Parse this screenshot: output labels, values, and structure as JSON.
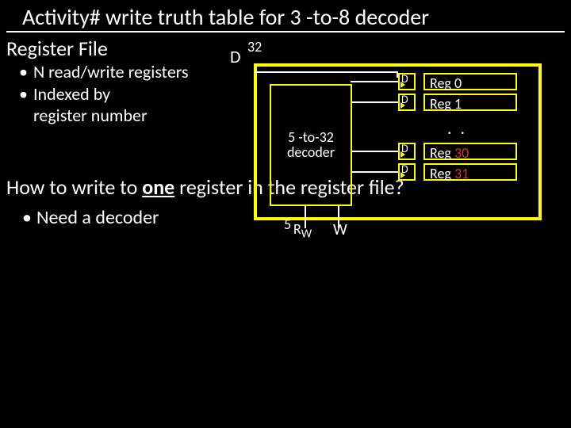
{
  "title": "Activity# write truth table for 3 -to-8 decoder",
  "subtitle": "Register File",
  "bullets": [
    "N read/write registers",
    "Indexed by",
    "register number"
  ],
  "diagram": {
    "D": "D",
    "D_width": "32",
    "decoder_line1": "5 -to-32",
    "decoder_line2": "decoder",
    "dff": "D",
    "reg0": "Reg 0",
    "reg1": "Reg 1",
    "dots": ". .",
    "reg30_prefix": "Reg ",
    "reg30_num": "30",
    "reg31_prefix": "Reg ",
    "reg31_num": "31",
    "rw_five": "5",
    "rw": "R",
    "rw_sub": "W",
    "w": "W"
  },
  "question_pre": "How to write to ",
  "question_one": "one",
  "question_post": " register in the register file?",
  "sub_bullet": "Need a decoder"
}
